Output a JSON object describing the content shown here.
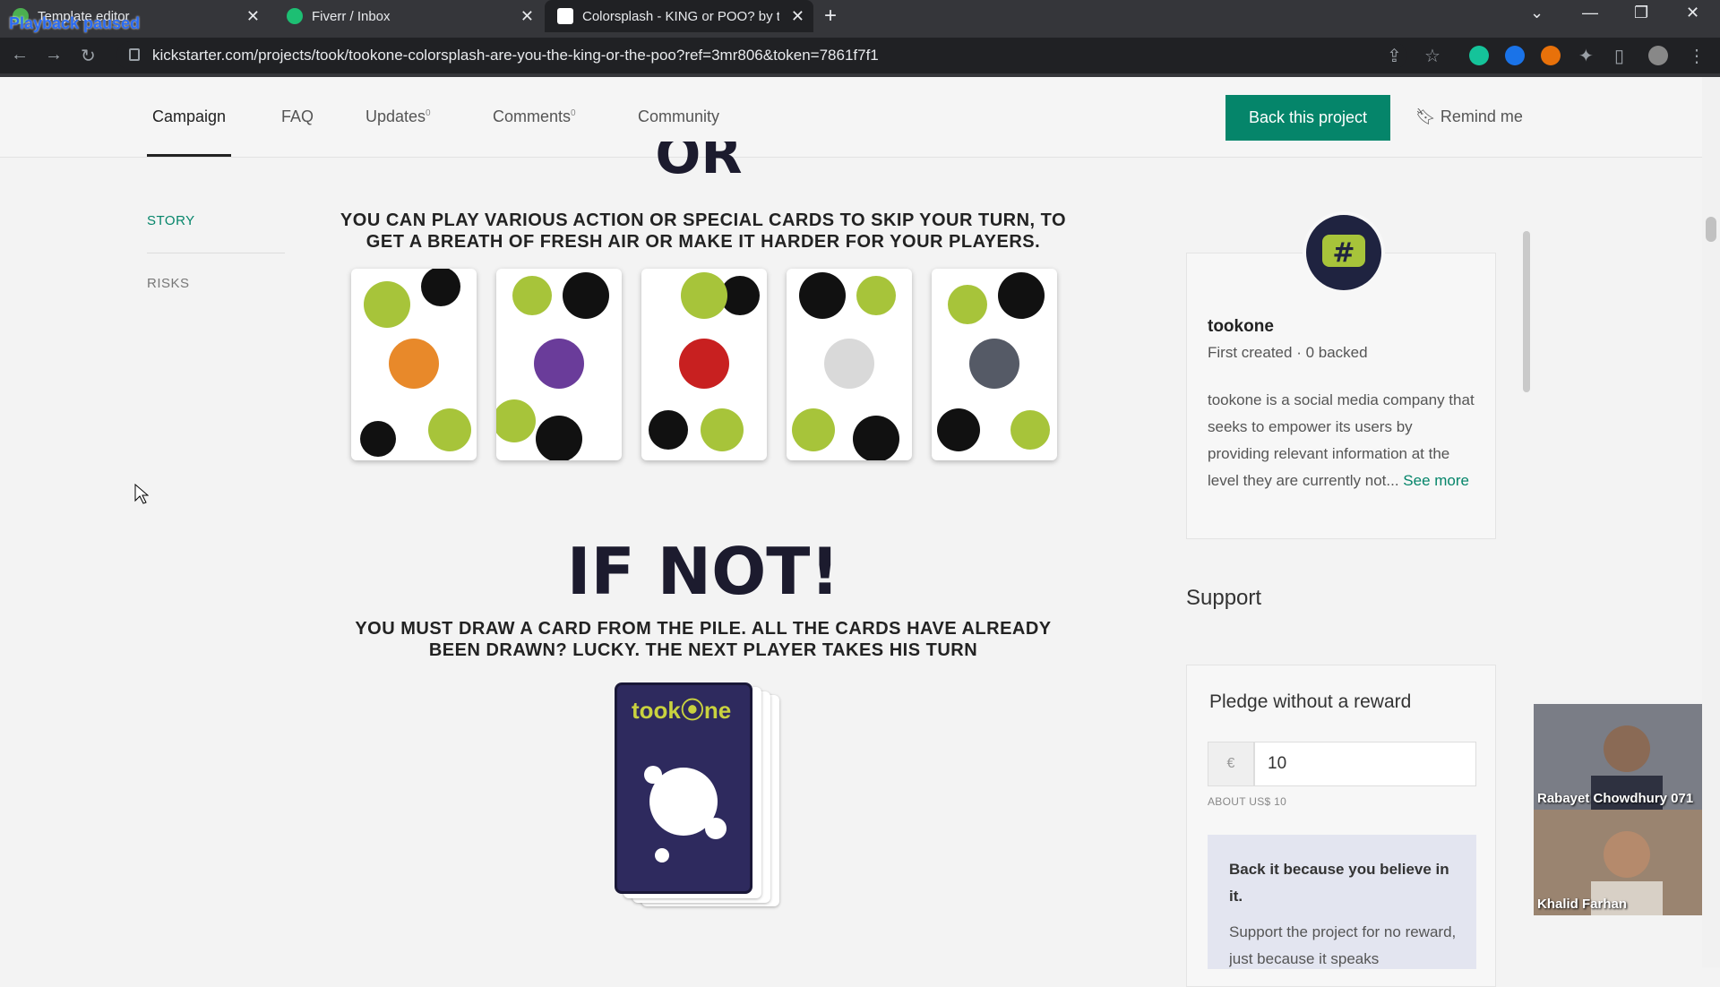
{
  "browser": {
    "tabs": [
      {
        "title": "Template editor",
        "active": false
      },
      {
        "title": "Fiverr / Inbox",
        "active": false
      },
      {
        "title": "Colorsplash - KING or POO? by t",
        "active": true
      }
    ],
    "playback_overlay": "Playback paused",
    "url": "kickstarter.com/projects/took/tookone-colorsplash-are-you-the-king-or-the-poo?ref=3mr806&token=7861f7f1"
  },
  "topnav": {
    "campaign": "Campaign",
    "faq": "FAQ",
    "updates": "Updates",
    "updates_count": "0",
    "comments": "Comments",
    "comments_count": "0",
    "community": "Community",
    "back_button": "Back this project",
    "remind": "Remind me"
  },
  "sidenav": {
    "story": "STORY",
    "risks": "RISKS"
  },
  "content": {
    "or_heading": "OR",
    "or_caption": "YOU CAN PLAY VARIOUS ACTION OR SPECIAL CARDS TO SKIP YOUR TURN, TO GET A BREATH OF FRESH AIR OR MAKE IT HARDER FOR YOUR PLAYERS.",
    "ifnot_heading": "IF NOT!",
    "ifnot_caption": "YOU MUST DRAW A CARD FROM THE PILE. ALL THE CARDS HAVE ALREADY BEEN DRAWN? LUCKY. THE NEXT PLAYER TAKES HIS TURN",
    "deck_brand": "took⦿ne"
  },
  "creator": {
    "name": "tookone",
    "meta": "First created · 0 backed",
    "bio": "tookone is a social media company that seeks to empower its users by providing relevant information at the level they are currently not... ",
    "see_more": "See more"
  },
  "support": {
    "heading": "Support",
    "pledge_title": "Pledge without a reward",
    "currency": "€",
    "amount": "10",
    "about": "ABOUT US$ 10",
    "believe_title": "Back it because you believe in it.",
    "believe_body": "Support the project for no reward, just because it speaks"
  },
  "video_call": [
    {
      "name": "Rabayet Chowdhury 071"
    },
    {
      "name": "Khalid Farhan"
    }
  ],
  "colors": {
    "accent": "#05856a",
    "chrome_dark": "#35363a",
    "heading": "#1c1b2e",
    "lime": "#a7c43a"
  }
}
